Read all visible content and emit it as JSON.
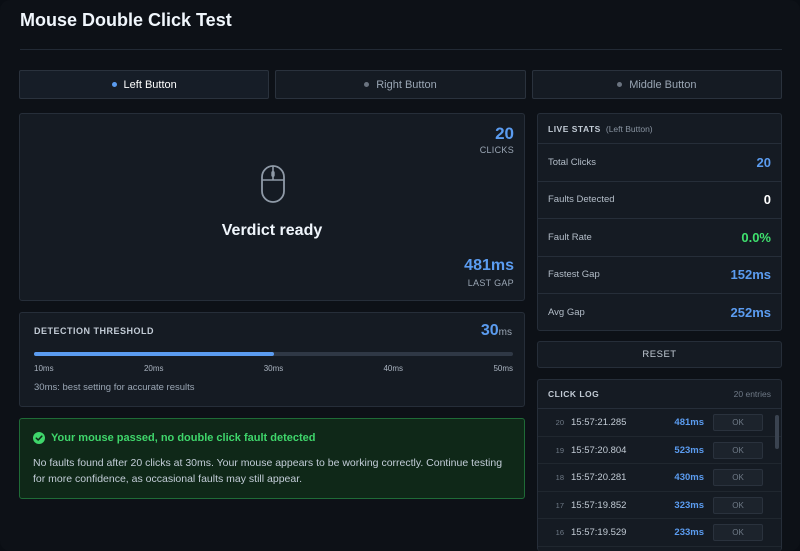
{
  "title": "Mouse Double Click Test",
  "tabs": [
    {
      "label": "Left Button",
      "active": true
    },
    {
      "label": "Right Button",
      "active": false
    },
    {
      "label": "Middle Button",
      "active": false
    }
  ],
  "click_area": {
    "count": "20",
    "count_label": "CLICKS",
    "verdict": "Verdict ready",
    "last_gap": "481ms",
    "last_gap_label": "LAST GAP",
    "icon": "mouse-icon"
  },
  "threshold": {
    "title": "DETECTION THRESHOLD",
    "value": "30",
    "unit": "ms",
    "fill_fraction": 0.5,
    "ticks": [
      "10ms",
      "20ms",
      "30ms",
      "40ms",
      "50ms"
    ],
    "note": "30ms: best setting for accurate results"
  },
  "result": {
    "icon": "check-circle-icon",
    "title": "Your mouse passed, no double click fault detected",
    "body": "No faults found after 20 clicks at 30ms. Your mouse appears to be working correctly. Continue testing for more confidence, as occasional faults may still appear."
  },
  "stats": {
    "title": "LIVE STATS",
    "subtitle": "(Left Button)",
    "rows": [
      {
        "label": "Total Clicks",
        "value": "20",
        "color": "#5b9cf0"
      },
      {
        "label": "Faults Detected",
        "value": "0",
        "color": "#ffffff"
      },
      {
        "label": "Fault Rate",
        "value": "0.0%",
        "color": "#3fe06e"
      },
      {
        "label": "Fastest Gap",
        "value": "152ms",
        "color": "#5b9cf0"
      },
      {
        "label": "Avg Gap",
        "value": "252ms",
        "color": "#5b9cf0"
      }
    ]
  },
  "reset_label": "RESET",
  "log": {
    "title": "CLICK LOG",
    "count": "20 entries",
    "rows": [
      {
        "index": "20",
        "time": "15:57:21.285",
        "gap": "481ms",
        "status": "OK"
      },
      {
        "index": "19",
        "time": "15:57:20.804",
        "gap": "523ms",
        "status": "OK"
      },
      {
        "index": "18",
        "time": "15:57:20.281",
        "gap": "430ms",
        "status": "OK"
      },
      {
        "index": "17",
        "time": "15:57:19.852",
        "gap": "323ms",
        "status": "OK"
      },
      {
        "index": "16",
        "time": "15:57:19.529",
        "gap": "233ms",
        "status": "OK"
      }
    ]
  },
  "colors": {
    "accent": "#5b9cf0",
    "success": "#3fd66b",
    "background": "#0d1117"
  }
}
